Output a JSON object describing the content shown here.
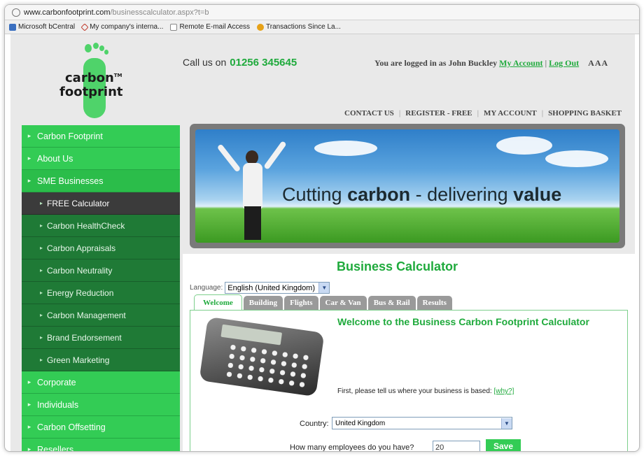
{
  "browser": {
    "url_host": "www.carbonfootprint.com",
    "url_path": "/businesscalculator.aspx?t=b",
    "favorites": [
      {
        "label": "Microsoft bCentral",
        "icon": "bcentral-icon"
      },
      {
        "label": "My company's interna...",
        "icon": "diamond-icon"
      },
      {
        "label": "Remote E-mail Access",
        "icon": "page-icon"
      },
      {
        "label": "Transactions Since La...",
        "icon": "transactions-icon"
      }
    ]
  },
  "header": {
    "logo_line1": "carbon",
    "logo_tm": "TM",
    "logo_line2": "footprint",
    "call_prefix": "Call us on",
    "phone": "01256 345645",
    "login_text": "You are logged in as John Buckley",
    "my_account": "My Account",
    "logout": "Log Out",
    "text_size": "AAA",
    "topnav": [
      "CONTACT US",
      "REGISTER - FREE",
      "MY ACCOUNT",
      "SHOPPING BASKET"
    ]
  },
  "sidebar": {
    "top": [
      {
        "label": "Carbon Footprint"
      },
      {
        "label": "About Us"
      },
      {
        "label": "SME Businesses"
      }
    ],
    "sub": [
      {
        "label": "FREE Calculator"
      },
      {
        "label": "Carbon HealthCheck"
      },
      {
        "label": "Carbon Appraisals"
      },
      {
        "label": "Carbon Neutrality"
      },
      {
        "label": "Energy Reduction"
      },
      {
        "label": "Carbon Management"
      },
      {
        "label": "Brand Endorsement"
      },
      {
        "label": "Green Marketing"
      }
    ],
    "bottom": [
      {
        "label": "Corporate"
      },
      {
        "label": "Individuals"
      },
      {
        "label": "Carbon Offsetting"
      },
      {
        "label": "Resellers"
      }
    ]
  },
  "banner": {
    "text_pre": "Cutting ",
    "text_bold1": "carbon",
    "text_mid": " - delivering ",
    "text_bold2": "value"
  },
  "calculator": {
    "title": "Business Calculator",
    "language_label": "Language:",
    "language_value": "English (United Kingdom)",
    "tabs": [
      "Welcome",
      "Building",
      "Flights",
      "Car & Van",
      "Bus & Rail",
      "Results"
    ],
    "welcome_heading": "Welcome to the Business Carbon Footprint Calculator",
    "based_text": "First, please tell us where your business is based:",
    "why_link": "[why?]",
    "country_label": "Country:",
    "country_value": "United Kingdom",
    "employees_label": "How many employees do you have?",
    "employees_value": "20",
    "save_label": "Save"
  },
  "colors": {
    "brand_green": "#33cc55",
    "dark_green": "#1f7a36",
    "link_green": "#1faa3c"
  }
}
